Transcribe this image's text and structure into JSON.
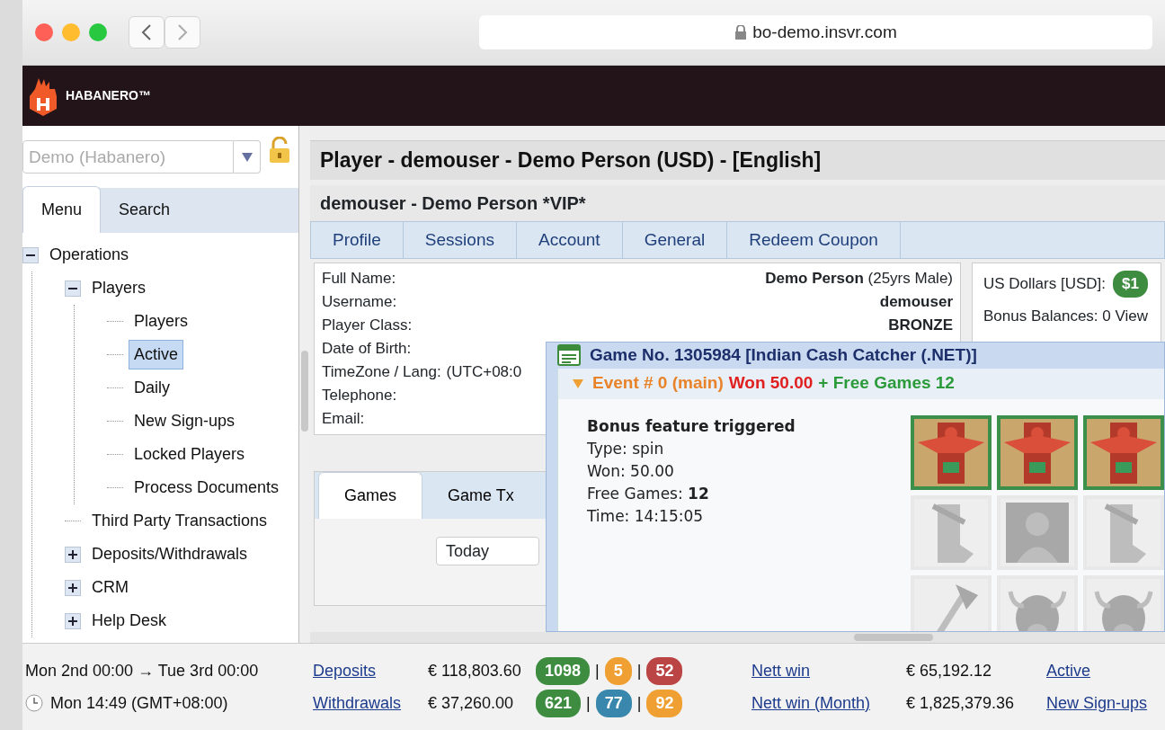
{
  "browser": {
    "url": "bo-demo.insvr.com"
  },
  "app": {
    "logo_text": "HABANERO™"
  },
  "sidebar": {
    "brand_select": {
      "placeholder": "Demo (Habanero)"
    },
    "tabs": [
      {
        "label": "Menu",
        "selected": true
      },
      {
        "label": "Search",
        "selected": false
      }
    ],
    "tree": [
      {
        "label": "Operations",
        "expanded": true,
        "selected": false,
        "children": [
          {
            "label": "Players",
            "expanded": true,
            "selected": false,
            "children": [
              {
                "label": "Players",
                "selected": false
              },
              {
                "label": "Active",
                "selected": true
              },
              {
                "label": "Daily",
                "selected": false
              },
              {
                "label": "New Sign-ups",
                "selected": false
              },
              {
                "label": "Locked Players",
                "selected": false
              },
              {
                "label": "Process Documents",
                "selected": false
              }
            ]
          },
          {
            "label": "Third Party Transactions",
            "selected": false
          },
          {
            "label": "Deposits/Withdrawals",
            "expanded": false,
            "selected": false
          },
          {
            "label": "CRM",
            "expanded": false,
            "selected": false
          },
          {
            "label": "Help Desk",
            "expanded": false,
            "selected": false
          }
        ]
      }
    ]
  },
  "main": {
    "title": "Player - demouser - Demo Person (USD) - [English]",
    "subtitle": "demouser - Demo Person *VIP*",
    "tabs": [
      {
        "label": "Profile",
        "selected": false
      },
      {
        "label": "Sessions",
        "selected": false
      },
      {
        "label": "Account",
        "selected": false
      },
      {
        "label": "General",
        "selected": false
      },
      {
        "label": "Redeem Coupon",
        "selected": false
      }
    ],
    "profile": [
      {
        "label": "Full Name:",
        "value": "**Demo Person** (25yrs Male)",
        "kind": "pair"
      },
      {
        "label": "Username:",
        "value": "**demouser**",
        "kind": "pair"
      },
      {
        "label": "Player Class:",
        "value": "**BRONZE**",
        "kind": "pair"
      },
      {
        "label": "Date of Birth:"
      },
      {
        "label": "TimeZone / Lang:",
        "value": "(UTC+08:0",
        "kind": "inline"
      },
      {
        "label": "Telephone:"
      },
      {
        "label": "Email:"
      }
    ],
    "balance": {
      "label": "US Dollars [USD]:",
      "amount": "$1"
    },
    "bonus": "Bonus Balances: 0 View",
    "lower_tabs": [
      {
        "label": "Games",
        "selected": true
      },
      {
        "label": "Game Tx",
        "selected": false
      }
    ],
    "period_select": {
      "value": "Today"
    }
  },
  "game_window": {
    "title": "Game No. 1305984 [Indian Cash Catcher (.NET)]",
    "event": {
      "label": "Event # 0 (main)",
      "won": "Won 50.00",
      "free_games": "+ Free Games 12",
      "expanded": true
    },
    "heading": "Bonus feature triggered",
    "details": [
      "Type: spin",
      "Won: 50.00",
      "Free Games: **12**",
      "Time: 14:15:05"
    ],
    "reels": [
      [
        {
          "kind": "totem",
          "highlighted": true
        },
        {
          "kind": "totem",
          "highlighted": true
        },
        {
          "kind": "totem",
          "highlighted": true
        }
      ],
      [
        {
          "kind": "boot",
          "highlighted": false
        },
        {
          "kind": "portrait",
          "highlighted": false
        },
        {
          "kind": "boot",
          "highlighted": false
        }
      ],
      [
        {
          "kind": "axe",
          "highlighted": false
        },
        {
          "kind": "buffalo",
          "highlighted": false
        },
        {
          "kind": "buffalo",
          "highlighted": false
        }
      ]
    ]
  },
  "status_bar": {
    "range": "Mon 2nd 00:00 → Tue 3rd 00:00",
    "clock": "Mon 14:49 (GMT+08:00)",
    "rows": [
      {
        "link": "Deposits",
        "amount": "€ 118,803.60",
        "counts": [
          {
            "value": "1098",
            "color": "#3d8c40"
          },
          {
            "value": "5",
            "color": "#f0a032"
          },
          {
            "value": "52",
            "color": "#bb4444"
          }
        ],
        "separator": "|",
        "link2": "Nett win",
        "amount2": "€ 65,192.12",
        "link3": "Active"
      },
      {
        "link": "Withdrawals",
        "amount": "€ 37,260.00",
        "counts": [
          {
            "value": "621",
            "color": "#3d8c40"
          },
          {
            "value": "77",
            "color": "#3a87ad"
          },
          {
            "value": "92",
            "color": "#f0a032"
          }
        ],
        "separator": "|",
        "link2": "Nett win (Month)",
        "amount2": "€ 1,825,379.36",
        "link3": "New Sign-ups"
      }
    ]
  }
}
